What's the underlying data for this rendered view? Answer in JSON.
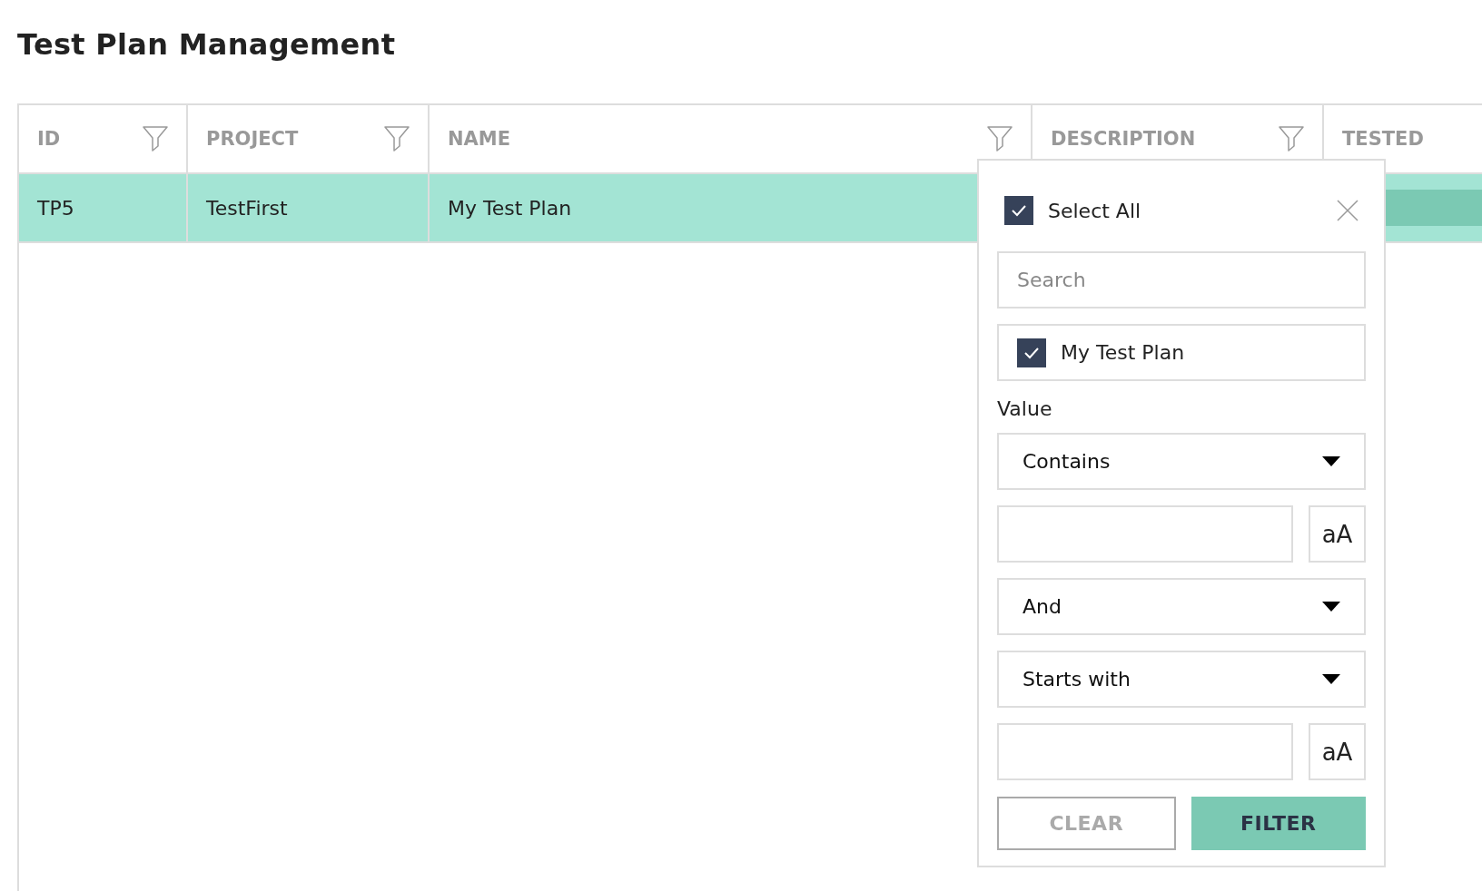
{
  "title": "Test Plan Management",
  "table": {
    "columns": [
      {
        "label": "ID",
        "filterable": true
      },
      {
        "label": "PROJECT",
        "filterable": true
      },
      {
        "label": "NAME",
        "filterable": true
      },
      {
        "label": "DESCRIPTION",
        "filterable": true
      },
      {
        "label": "TESTED",
        "filterable": false
      }
    ],
    "rows": [
      {
        "selected": true,
        "id": "TP5",
        "project": "TestFirst",
        "name": "My Test Plan"
      }
    ]
  },
  "filter_popup": {
    "select_all": {
      "label": "Select All",
      "checked": true
    },
    "search": {
      "placeholder": "Search"
    },
    "values": [
      {
        "label": "My Test Plan",
        "checked": true
      }
    ],
    "value_label": "Value",
    "conditions": [
      {
        "operator": "Contains",
        "case_toggle": "aA"
      },
      {
        "operator": "Starts with",
        "case_toggle": "aA"
      }
    ],
    "join": "And",
    "buttons": [
      {
        "label": "CLEAR",
        "kind": "secondary"
      },
      {
        "label": "FILTER",
        "kind": "primary"
      }
    ]
  }
}
